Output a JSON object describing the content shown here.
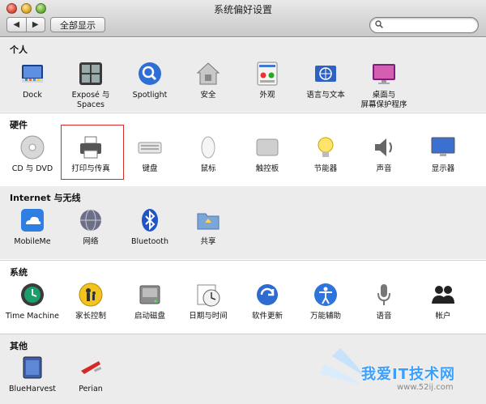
{
  "window": {
    "title": "系统偏好设置"
  },
  "toolbar": {
    "back": "◀",
    "forward": "▶",
    "show_all": "全部显示",
    "search_placeholder": ""
  },
  "sections": [
    {
      "title": "个人",
      "items": [
        "Dock",
        "Exposé 与\nSpaces",
        "Spotlight",
        "安全",
        "外观",
        "语言与文本",
        "桌面与\n屏幕保护程序"
      ]
    },
    {
      "title": "硬件",
      "items": [
        "CD 与 DVD",
        "打印与传真",
        "键盘",
        "鼠标",
        "触控板",
        "节能器",
        "声音",
        "显示器"
      ]
    },
    {
      "title": "Internet 与无线",
      "items": [
        "MobileMe",
        "网络",
        "Bluetooth",
        "共享"
      ]
    },
    {
      "title": "系统",
      "items": [
        "Time Machine",
        "家长控制",
        "启动磁盘",
        "日期与时间",
        "软件更新",
        "万能辅助",
        "语音",
        "帐户"
      ]
    },
    {
      "title": "其他",
      "items": [
        "BlueHarvest",
        "Perian"
      ]
    }
  ],
  "icons": {
    "s0": [
      "dock-icon",
      "expose-spaces-icon",
      "spotlight-icon",
      "security-icon",
      "appearance-icon",
      "language-text-icon",
      "desktop-screensaver-icon"
    ],
    "s1": [
      "cd-dvd-icon",
      "printer-icon",
      "keyboard-icon",
      "mouse-icon",
      "trackpad-icon",
      "energy-saver-icon",
      "sound-icon",
      "display-icon"
    ],
    "s2": [
      "mobileme-icon",
      "network-icon",
      "bluetooth-icon",
      "sharing-icon"
    ],
    "s3": [
      "time-machine-icon",
      "parental-controls-icon",
      "startup-disk-icon",
      "date-time-icon",
      "software-update-icon",
      "universal-access-icon",
      "speech-icon",
      "accounts-icon"
    ],
    "s4": [
      "blueharvest-icon",
      "perian-icon"
    ]
  },
  "watermark": {
    "title": "我爱IT技术网",
    "url": "www.52ij.com"
  },
  "colors": {
    "highlight_box": "#d42a2a",
    "section_shade": "#ececec"
  }
}
